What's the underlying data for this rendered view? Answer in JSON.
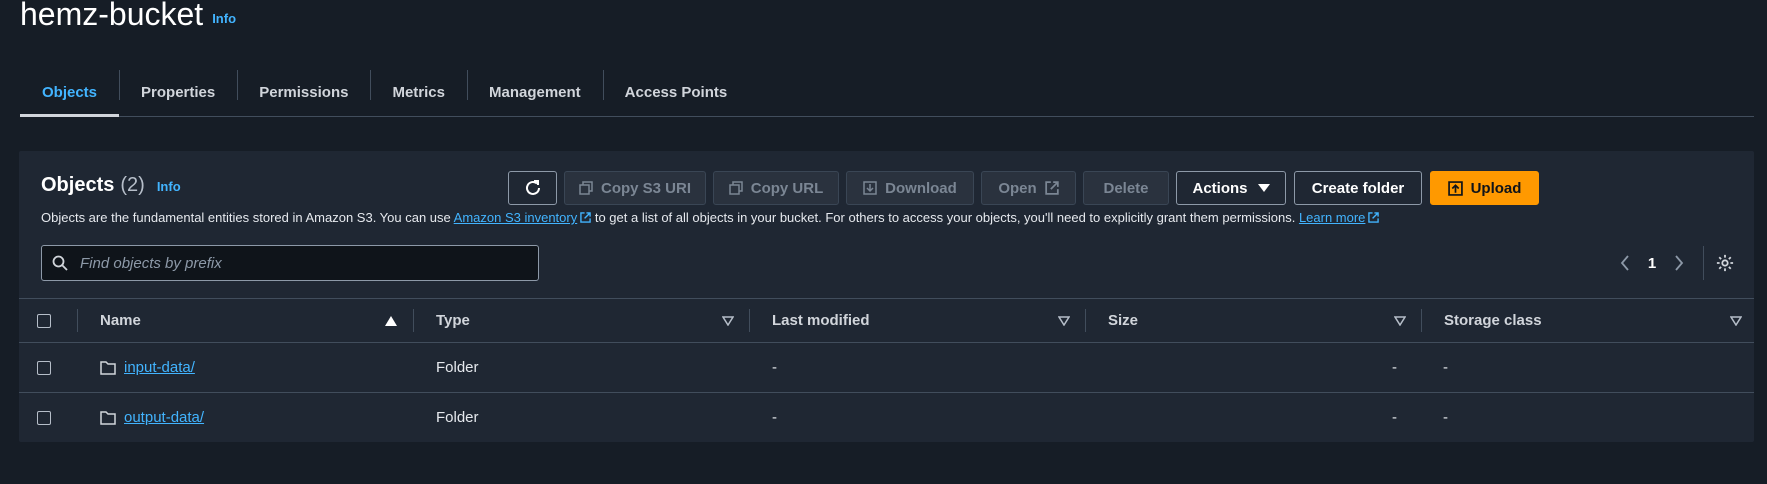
{
  "bucket": {
    "title": "hemz-bucket",
    "info_label": "Info"
  },
  "tabs": [
    {
      "label": "Objects",
      "active": true
    },
    {
      "label": "Properties"
    },
    {
      "label": "Permissions"
    },
    {
      "label": "Metrics"
    },
    {
      "label": "Management"
    },
    {
      "label": "Access Points"
    }
  ],
  "objects": {
    "title": "Objects",
    "count": "(2)",
    "info_label": "Info",
    "description": {
      "prefix": "Objects are the fundamental entities stored in Amazon S3. You can use ",
      "inventory_link": "Amazon S3 inventory",
      "middle": " to get a list of all objects in your bucket. For others to access your objects, you'll need to explicitly grant them permissions. ",
      "learn_more": "Learn more"
    }
  },
  "toolbar": {
    "refresh_icon": "refresh-icon",
    "copy_s3_uri": "Copy S3 URI",
    "copy_url": "Copy URL",
    "download": "Download",
    "open": "Open",
    "delete": "Delete",
    "actions": "Actions",
    "create_folder": "Create folder",
    "upload": "Upload"
  },
  "search": {
    "placeholder": "Find objects by prefix",
    "value": ""
  },
  "pagination": {
    "current_page": "1"
  },
  "table": {
    "columns": [
      "Name",
      "Type",
      "Last modified",
      "Size",
      "Storage class"
    ],
    "sorted_by": "Name",
    "rows": [
      {
        "name": "input-data/",
        "type": "Folder",
        "last_modified": "-",
        "size": "-",
        "storage_class": "-"
      },
      {
        "name": "output-data/",
        "type": "Folder",
        "last_modified": "-",
        "size": "-",
        "storage_class": "-"
      }
    ]
  },
  "colors": {
    "background": "#161d26",
    "panel": "#1f2733",
    "link": "#42b4ff",
    "primary_button": "#ff9900"
  }
}
